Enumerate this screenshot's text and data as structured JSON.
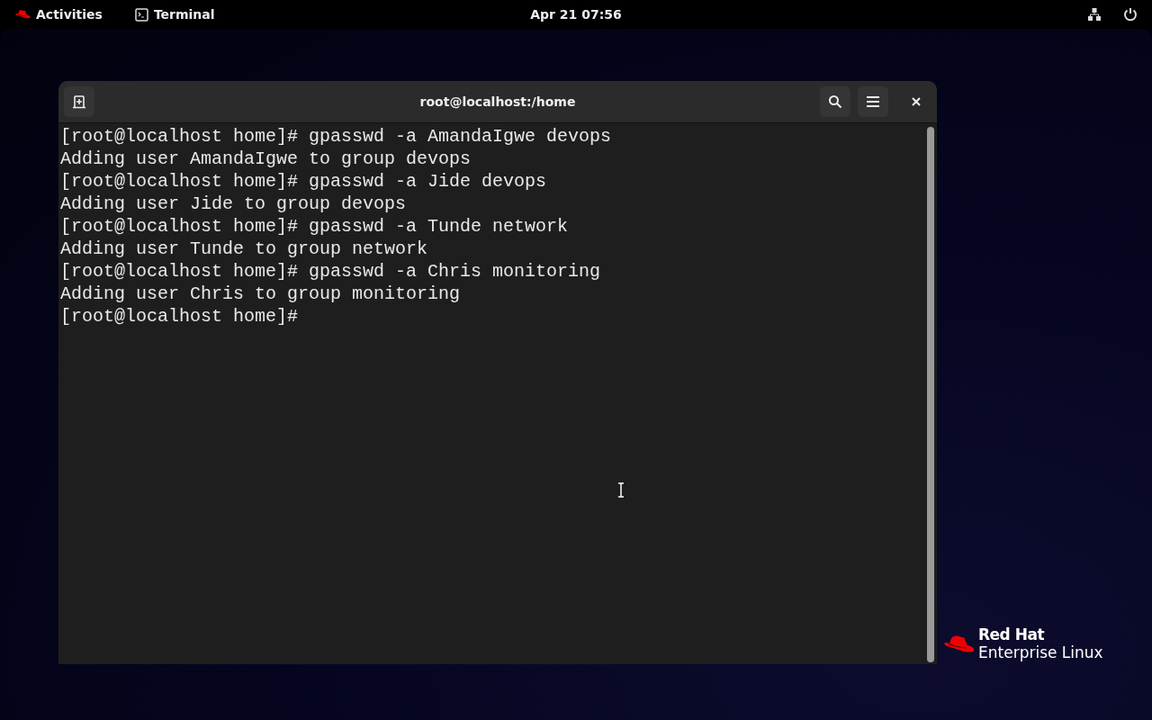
{
  "top_bar": {
    "activities": "Activities",
    "app": "Terminal",
    "clock": "Apr 21  07:56"
  },
  "window": {
    "title": "root@localhost:/home",
    "lines": [
      "[root@localhost home]# gpasswd -a AmandaIgwe devops",
      "Adding user AmandaIgwe to group devops",
      "[root@localhost home]# gpasswd -a Jide devops",
      "Adding user Jide to group devops",
      "[root@localhost home]# gpasswd -a Tunde network",
      "Adding user Tunde to group network",
      "[root@localhost home]# gpasswd -a Chris monitoring",
      "Adding user Chris to group monitoring",
      "[root@localhost home]#"
    ]
  },
  "logo": {
    "brand": "Red Hat",
    "product": "Enterprise Linux"
  }
}
